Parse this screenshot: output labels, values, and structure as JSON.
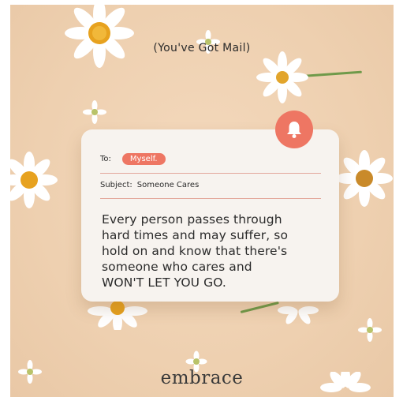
{
  "header": {
    "text": "(You've Got Mail)"
  },
  "card": {
    "to_label": "To:",
    "to_value": "Myself.",
    "subject_label": "Subject:",
    "subject_value": "Someone Cares",
    "message_lines": [
      "Every person passes through",
      "hard times and may suffer, so",
      "hold on and know that there's",
      "someone who cares and",
      "WON'T LET YOU GO."
    ],
    "accent": "#ee7663"
  },
  "brand": {
    "name": "embrace"
  },
  "icons": {
    "notification": "bell-icon",
    "decoration": "daisy-icon"
  },
  "colors": {
    "background": "#f2d5b6",
    "card": "#f7f3ef",
    "accent": "#ee7663",
    "text": "#2b2b2b"
  }
}
